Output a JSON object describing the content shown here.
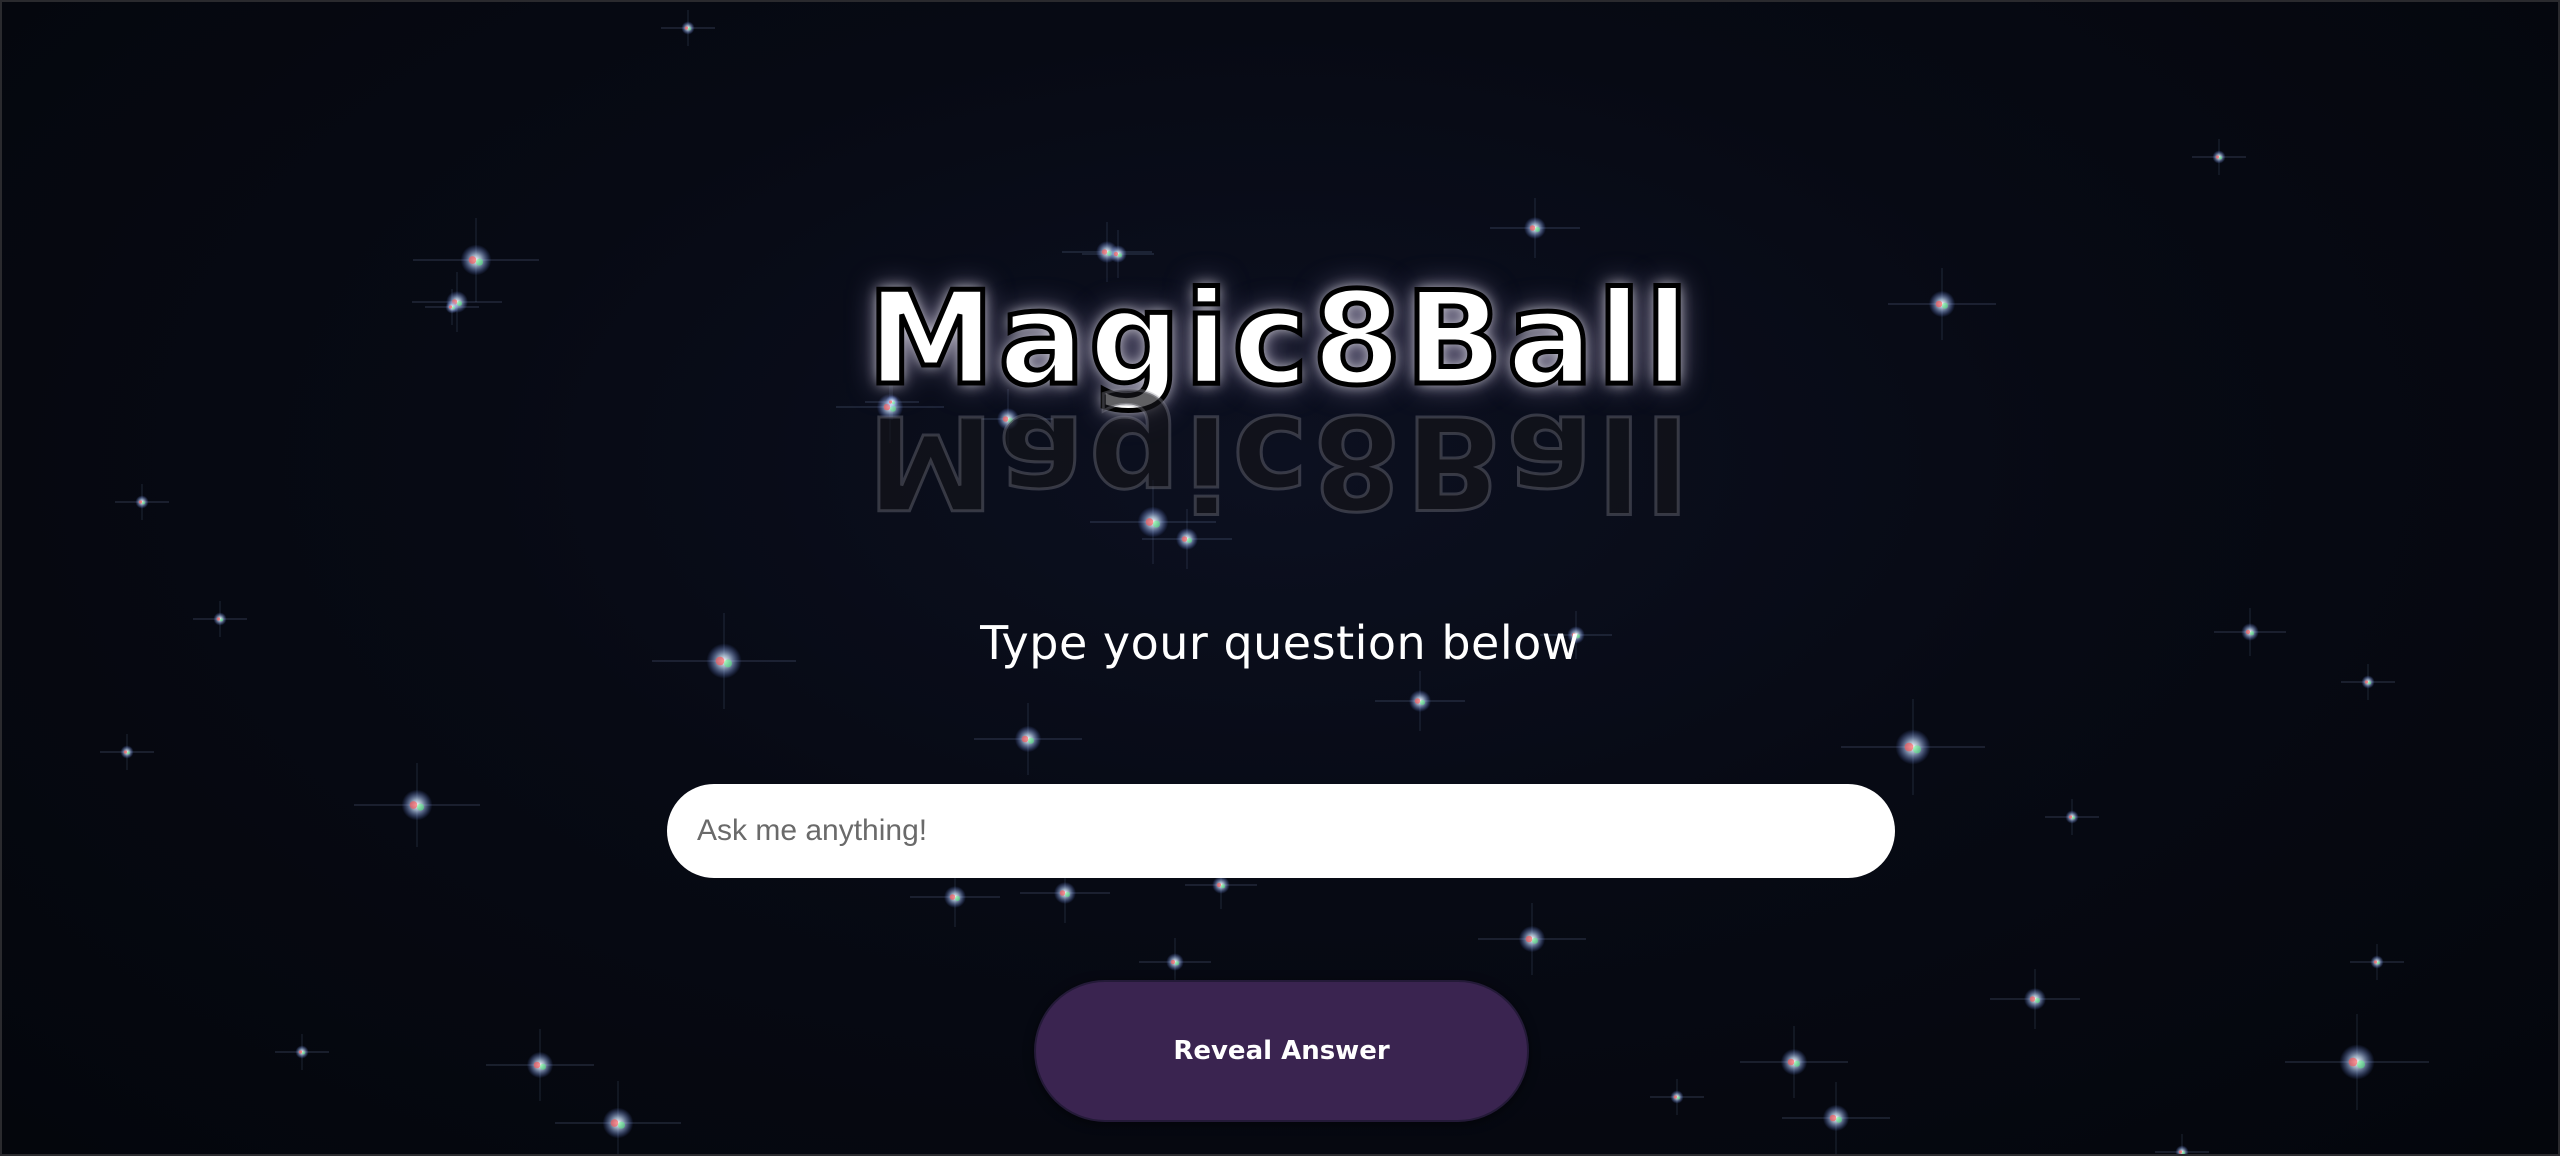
{
  "header": {
    "logo_text": "Magic8Ball"
  },
  "main": {
    "prompt_text": "Type your question below",
    "question_input": {
      "value": "",
      "placeholder": "Ask me anything!"
    },
    "reveal_button_label": "Reveal Answer"
  },
  "colors": {
    "background": "#05070d",
    "button_background": "#3a2450",
    "input_background": "#ffffff",
    "text": "#ffffff"
  }
}
